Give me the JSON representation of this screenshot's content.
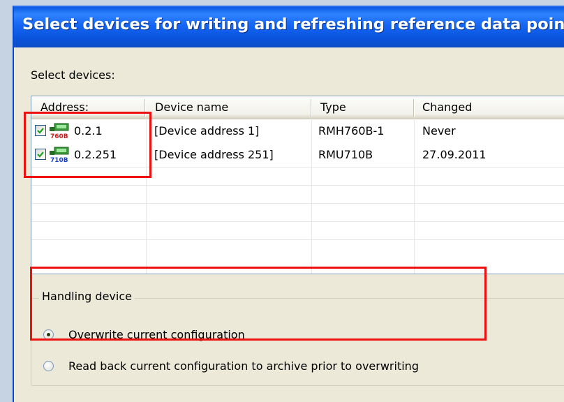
{
  "window": {
    "title": "Select devices for writing and refreshing reference data points"
  },
  "devices_section": {
    "label": "Select devices:",
    "columns": [
      "Address:",
      "Device name",
      "Type",
      "Changed"
    ],
    "rows": [
      {
        "checked": true,
        "icon": "device-rmh760b-icon",
        "address": "0.2.1",
        "device_name": "[Device address 1]",
        "type": "RMH760B-1",
        "changed": "Never"
      },
      {
        "checked": true,
        "icon": "device-rmu710b-icon",
        "address": "0.2.251",
        "device_name": "[Device address 251]",
        "type": "RMU710B",
        "changed": "27.09.2011"
      }
    ]
  },
  "handling": {
    "title": "Handling device",
    "options": [
      {
        "label": "Overwrite current configuration",
        "selected": true
      },
      {
        "label": "Read back current configuration to archive prior to overwriting",
        "selected": false
      }
    ]
  },
  "colors": {
    "titlebar": "#0a55de",
    "highlight": "#ee0f0f",
    "dialog_bg": "#ece9d8"
  }
}
